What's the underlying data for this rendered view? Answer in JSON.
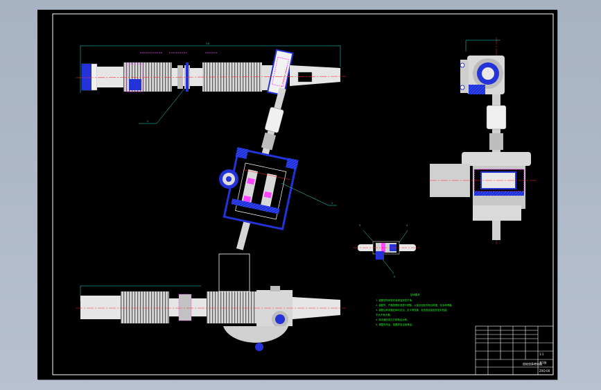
{
  "drawing": {
    "tech_title": "技术要求",
    "tech_notes": [
      "1. 装配前所有零件用煤油清洗干净。",
      "2. 装配时，严格按照标准进行调整，以保证齿轮的啮合精度，并涂润滑脂。",
      "3. 装配后转向器应转动灵活，无卡滞现象，检查各连接处的密封性能，",
      "   不允许有渗漏。",
      "4. 转向器总成左右转角应对称。",
      "5. 调整完毕后，按要求加注润滑油。"
    ],
    "leaders": [
      "1",
      "2",
      "3",
      "4",
      "5"
    ],
    "title_block": {
      "name": "齿轮齿条转向器",
      "drawing_no": "ZXQ-00",
      "scale": "1:1",
      "sheet": "共1张"
    }
  },
  "colors": {
    "background": "#000000",
    "frame": "#ffffff",
    "centerline": "#ff2a2a",
    "dimension": "#33e0e0",
    "section": "#3a55ff",
    "highlight": "#ff44ff",
    "notes": "#2bf02b"
  }
}
